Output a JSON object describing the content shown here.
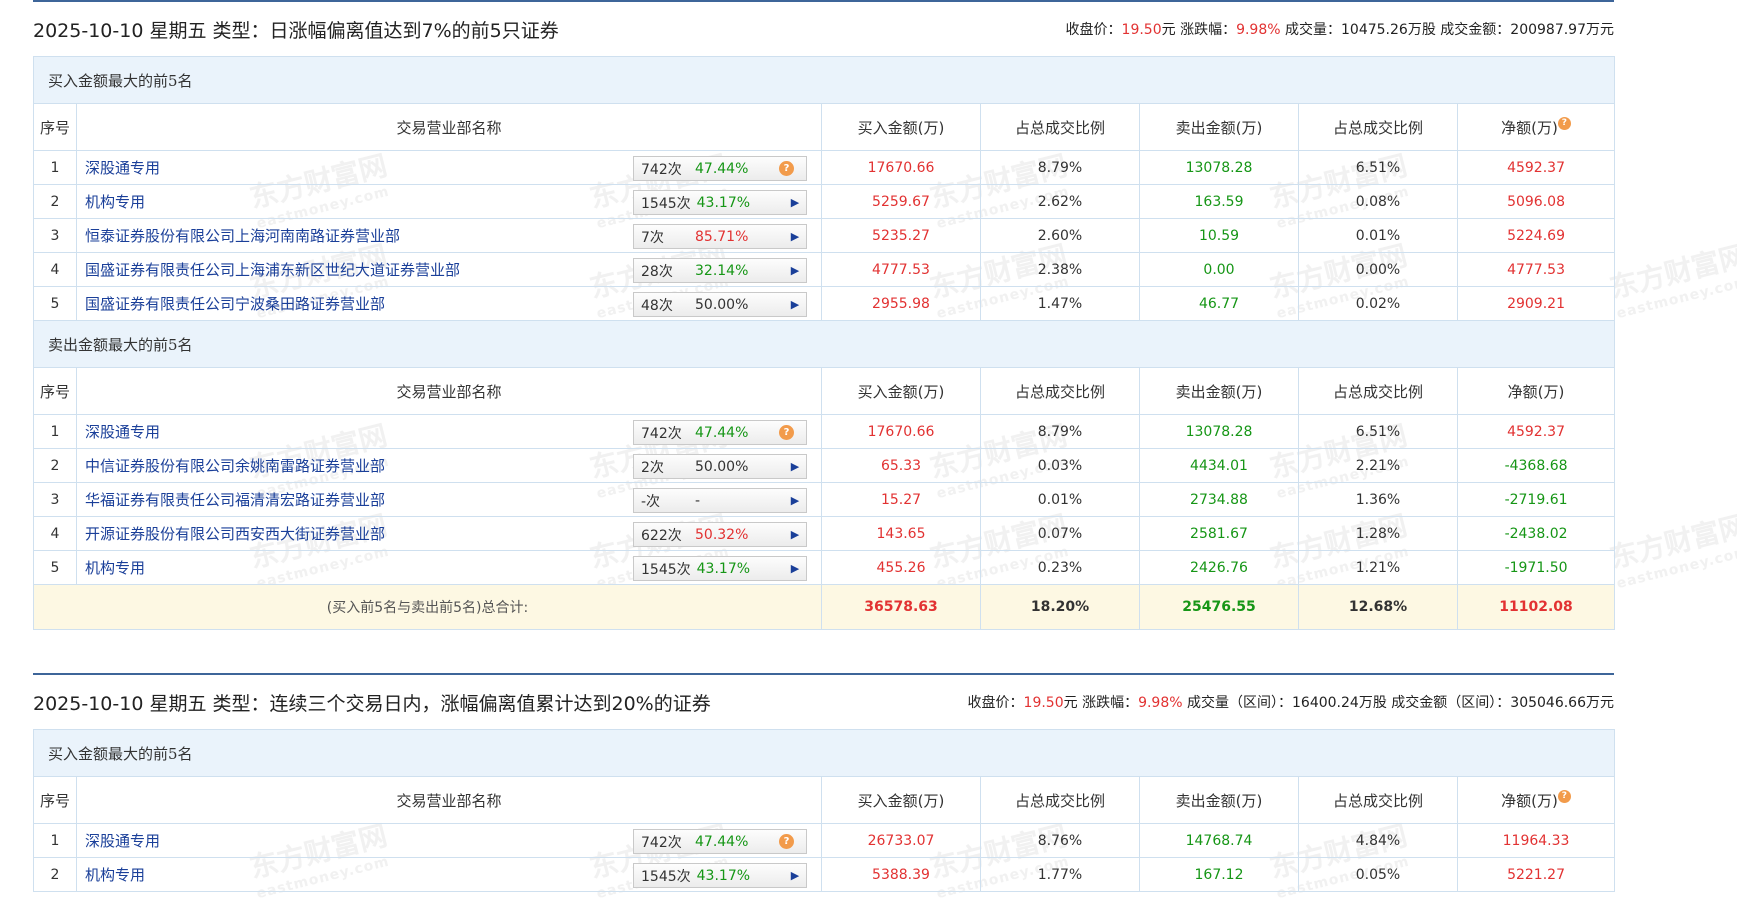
{
  "watermark": {
    "text": "东方财富网",
    "sub": "eastmoney.com"
  },
  "sections": [
    {
      "title": "2025-10-10 星期五 类型：日涨幅偏离值达到7%的前5只证券",
      "summary": [
        {
          "label": "收盘价：",
          "value": "19.50",
          "unit": "元"
        },
        {
          "label": "涨跌幅：",
          "value": "9.98%",
          "unit": ""
        },
        {
          "label": "成交量：",
          "value": "10475.26万股",
          "unit": ""
        },
        {
          "label": "成交金额：",
          "value": "200987.97万元",
          "unit": ""
        }
      ],
      "buy_group_title": "买入金额最大的前5名",
      "sell_group_title": "卖出金额最大的前5名",
      "columns": [
        "序号",
        "交易营业部名称",
        "买入金额(万)",
        "占总成交比例",
        "卖出金额(万)",
        "占总成交比例",
        "净额(万)"
      ],
      "buy_rows": [
        {
          "no": "1",
          "name": "深股通专用",
          "count": "742次",
          "pct": "47.44%",
          "pct_color": "green",
          "action": "q",
          "buy": "17670.66",
          "buy_ratio": "8.79%",
          "sell": "13078.28",
          "sell_ratio": "6.51%",
          "net": "4592.37",
          "net_color": "red"
        },
        {
          "no": "2",
          "name": "机构专用",
          "count": "1545次",
          "pct": "43.17%",
          "pct_color": "green",
          "action": "arrow",
          "buy": "5259.67",
          "buy_ratio": "2.62%",
          "sell": "163.59",
          "sell_ratio": "0.08%",
          "net": "5096.08",
          "net_color": "red"
        },
        {
          "no": "3",
          "name": "恒泰证券股份有限公司上海河南南路证券营业部",
          "count": "7次",
          "pct": "85.71%",
          "pct_color": "red",
          "action": "arrow",
          "buy": "5235.27",
          "buy_ratio": "2.60%",
          "sell": "10.59",
          "sell_ratio": "0.01%",
          "net": "5224.69",
          "net_color": "red"
        },
        {
          "no": "4",
          "name": "国盛证券有限责任公司上海浦东新区世纪大道证券营业部",
          "count": "28次",
          "pct": "32.14%",
          "pct_color": "green",
          "action": "arrow",
          "buy": "4777.53",
          "buy_ratio": "2.38%",
          "sell": "0.00",
          "sell_ratio": "0.00%",
          "net": "4777.53",
          "net_color": "red"
        },
        {
          "no": "5",
          "name": "国盛证券有限责任公司宁波桑田路证券营业部",
          "count": "48次",
          "pct": "50.00%",
          "pct_color": "gray",
          "action": "arrow",
          "buy": "2955.98",
          "buy_ratio": "1.47%",
          "sell": "46.77",
          "sell_ratio": "0.02%",
          "net": "2909.21",
          "net_color": "red"
        }
      ],
      "sell_rows": [
        {
          "no": "1",
          "name": "深股通专用",
          "count": "742次",
          "pct": "47.44%",
          "pct_color": "green",
          "action": "q",
          "buy": "17670.66",
          "buy_ratio": "8.79%",
          "sell": "13078.28",
          "sell_ratio": "6.51%",
          "net": "4592.37",
          "net_color": "red"
        },
        {
          "no": "2",
          "name": "中信证券股份有限公司余姚南雷路证券营业部",
          "count": "2次",
          "pct": "50.00%",
          "pct_color": "gray",
          "action": "arrow",
          "buy": "65.33",
          "buy_ratio": "0.03%",
          "sell": "4434.01",
          "sell_ratio": "2.21%",
          "net": "-4368.68",
          "net_color": "green"
        },
        {
          "no": "3",
          "name": "华福证券有限责任公司福清清宏路证券营业部",
          "count": "-次",
          "pct": "-",
          "pct_color": "gray",
          "action": "arrow",
          "buy": "15.27",
          "buy_ratio": "0.01%",
          "sell": "2734.88",
          "sell_ratio": "1.36%",
          "net": "-2719.61",
          "net_color": "green"
        },
        {
          "no": "4",
          "name": "开源证券股份有限公司西安西大街证券营业部",
          "count": "622次",
          "pct": "50.32%",
          "pct_color": "red",
          "action": "arrow",
          "buy": "143.65",
          "buy_ratio": "0.07%",
          "sell": "2581.67",
          "sell_ratio": "1.28%",
          "net": "-2438.02",
          "net_color": "green"
        },
        {
          "no": "5",
          "name": "机构专用",
          "count": "1545次",
          "pct": "43.17%",
          "pct_color": "green",
          "action": "arrow",
          "buy": "455.26",
          "buy_ratio": "0.23%",
          "sell": "2426.76",
          "sell_ratio": "1.21%",
          "net": "-1971.50",
          "net_color": "green"
        }
      ],
      "total": {
        "label": "(买入前5名与卖出前5名)总合计:",
        "buy": "36578.63",
        "buy_ratio": "18.20%",
        "sell": "25476.55",
        "sell_ratio": "12.68%",
        "net": "11102.08"
      }
    },
    {
      "title": "2025-10-10 星期五 类型：连续三个交易日内，涨幅偏离值累计达到20%的证券",
      "summary": [
        {
          "label": "收盘价：",
          "value": "19.50",
          "unit": "元"
        },
        {
          "label": "涨跌幅：",
          "value": "9.98%",
          "unit": ""
        },
        {
          "label": "成交量（区间）：",
          "value": "16400.24万股",
          "unit": ""
        },
        {
          "label": "成交金额（区间）：",
          "value": "305046.66万元",
          "unit": ""
        }
      ],
      "buy_group_title": "买入金额最大的前5名",
      "columns": [
        "序号",
        "交易营业部名称",
        "买入金额(万)",
        "占总成交比例",
        "卖出金额(万)",
        "占总成交比例",
        "净额(万)"
      ],
      "buy_rows": [
        {
          "no": "1",
          "name": "深股通专用",
          "count": "742次",
          "pct": "47.44%",
          "pct_color": "green",
          "action": "q",
          "buy": "26733.07",
          "buy_ratio": "8.76%",
          "sell": "14768.74",
          "sell_ratio": "4.84%",
          "net": "11964.33",
          "net_color": "red"
        },
        {
          "no": "2",
          "name": "机构专用",
          "count": "1545次",
          "pct": "43.17%",
          "pct_color": "green",
          "action": "arrow",
          "buy": "5388.39",
          "buy_ratio": "1.77%",
          "sell": "167.12",
          "sell_ratio": "0.05%",
          "net": "5221.27",
          "net_color": "red"
        }
      ]
    }
  ]
}
